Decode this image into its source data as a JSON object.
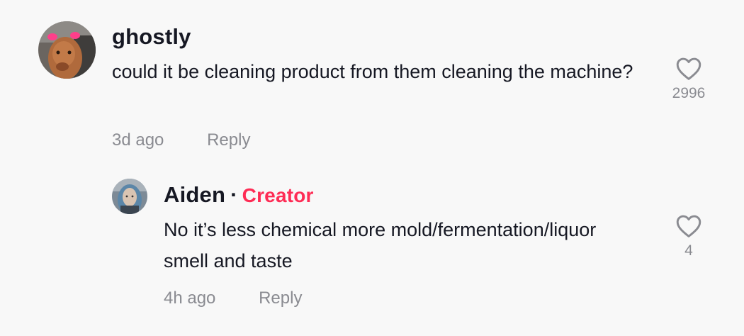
{
  "comments": [
    {
      "username": "ghostly",
      "text": "could it be cleaning product from them cleaning the machine?",
      "time": "3d ago",
      "reply_label": "Reply",
      "like_count": "2996",
      "avatar_icon": "calf-photo-avatar"
    },
    {
      "username": "Aiden",
      "separator": "·",
      "badge": "Creator",
      "text": "No it’s less chemical more mold/fermentation/liquor smell and taste",
      "time": "4h ago",
      "reply_label": "Reply",
      "like_count": "4",
      "avatar_icon": "person-photo-avatar"
    }
  ],
  "colors": {
    "background": "#f8f8f8",
    "creator_badge": "#fe2c55",
    "meta_text": "#8a8b91",
    "primary_text": "#161823"
  },
  "icons": {
    "like": "heart-outline-icon"
  }
}
